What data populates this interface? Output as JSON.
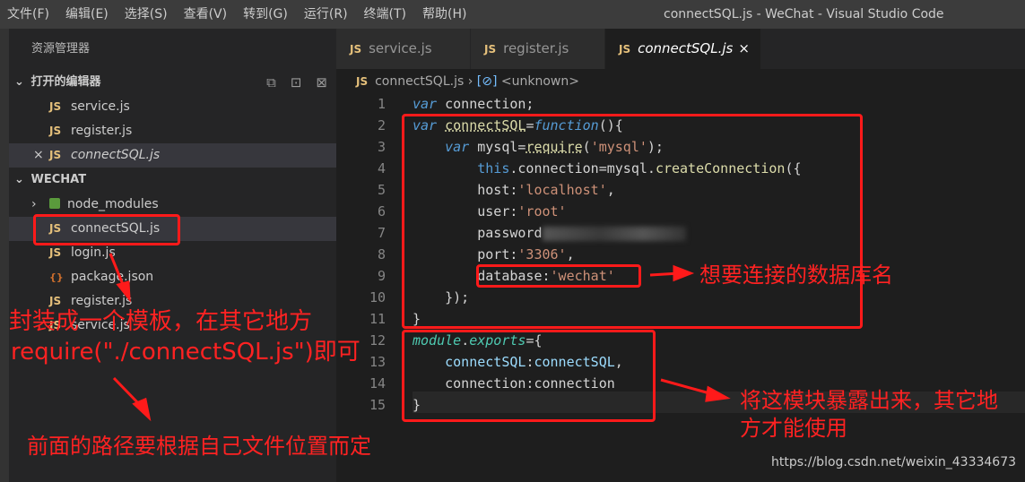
{
  "menubar": {
    "items": [
      "文件(F)",
      "编辑(E)",
      "选择(S)",
      "查看(V)",
      "转到(G)",
      "运行(R)",
      "终端(T)",
      "帮助(H)"
    ],
    "window_title": "connectSQL.js - WeChat - Visual Studio Code"
  },
  "sidebar": {
    "title": "资源管理器",
    "open_editors": {
      "label": "打开的编辑器",
      "files": [
        {
          "icon": "JS",
          "name": "service.js"
        },
        {
          "icon": "JS",
          "name": "register.js"
        },
        {
          "icon": "JS",
          "name": "connectSQL.js",
          "close": "×"
        }
      ]
    },
    "project": {
      "label": "WECHAT",
      "items": [
        {
          "name": "node_modules"
        },
        {
          "icon": "JS",
          "name": "connectSQL.js"
        },
        {
          "icon": "JS",
          "name": "login.js"
        },
        {
          "icon": "{}",
          "name": "package.json"
        },
        {
          "icon": "JS",
          "name": "register.js"
        },
        {
          "icon": "JS",
          "name": "service.js"
        }
      ]
    }
  },
  "tabs": [
    {
      "icon": "JS",
      "label": "service.js"
    },
    {
      "icon": "JS",
      "label": "register.js"
    },
    {
      "icon": "JS",
      "label": "connectSQL.js",
      "close": "×"
    }
  ],
  "breadcrumb": {
    "file": "connectSQL.js",
    "separator": "›",
    "symbol": "<unknown>"
  },
  "editor": {
    "line_numbers": [
      "1",
      "2",
      "3",
      "4",
      "5",
      "6",
      "7",
      "8",
      "9",
      "10",
      "11",
      "12",
      "13",
      "14",
      "15"
    ],
    "lines": [
      [
        [
          "kw",
          "var"
        ],
        [
          "pl",
          " connection;"
        ]
      ],
      [
        [
          "kw",
          "var"
        ],
        [
          "pl",
          " "
        ],
        [
          "fnv",
          "connectSQL"
        ],
        [
          "op",
          "="
        ],
        [
          "kw",
          "function"
        ],
        [
          "pl",
          "(){"
        ]
      ],
      [
        [
          "pl",
          "    "
        ],
        [
          "kw",
          "var"
        ],
        [
          "pl",
          " mysql"
        ],
        [
          "op",
          "="
        ],
        [
          "fnv",
          "require"
        ],
        [
          "pl",
          "("
        ],
        [
          "str",
          "'mysql'"
        ],
        [
          "pl",
          ");"
        ]
      ],
      [
        [
          "pl",
          "        "
        ],
        [
          "this",
          "this"
        ],
        [
          "pl",
          ".connection"
        ],
        [
          "op",
          "="
        ],
        [
          "pl",
          "mysql."
        ],
        [
          "mem",
          "createConnection"
        ],
        [
          "pl",
          "({"
        ]
      ],
      [
        [
          "pl",
          "        host:"
        ],
        [
          "str",
          "'localhost'"
        ],
        [
          "pl",
          ","
        ]
      ],
      [
        [
          "pl",
          "        user:"
        ],
        [
          "str",
          "'root'"
        ]
      ],
      [
        [
          "pl",
          "        password"
        ]
      ],
      [
        [
          "pl",
          "        port:"
        ],
        [
          "str",
          "'3306'"
        ],
        [
          "pl",
          ","
        ]
      ],
      [
        [
          "pl",
          "        database:"
        ],
        [
          "str",
          "'wechat'"
        ]
      ],
      [
        [
          "pl",
          "    });"
        ]
      ],
      [
        [
          "pl",
          "}"
        ]
      ],
      [
        [
          "mod",
          "module"
        ],
        [
          "pl",
          "."
        ],
        [
          "mod",
          "exports"
        ],
        [
          "op",
          "="
        ],
        [
          "pl",
          "{"
        ]
      ],
      [
        [
          "pl",
          "    "
        ],
        [
          "var",
          "connectSQL"
        ],
        [
          "pl",
          ":"
        ],
        [
          "var",
          "connectSQL"
        ],
        [
          "pl",
          ","
        ]
      ],
      [
        [
          "pl",
          "    connection:connection"
        ]
      ],
      [
        [
          "pl",
          "}"
        ]
      ]
    ]
  },
  "annotations": {
    "db_name": "想要连接的数据库名",
    "template_line1": "封装成一个模板，在其它地方",
    "template_line2": "require(\"./connectSQL.js\")即可",
    "path_note": "前面的路径要根据自己文件位置而定",
    "export_line1": "将这模块暴露出来，其它地",
    "export_line2": "方才能使用"
  },
  "watermark": "https://blog.csdn.net/weixin_43334673",
  "colors": {
    "annotation_red": "#ff1a1a",
    "js_icon": "#e5c07b",
    "keyword": "#569cd6",
    "string": "#ce9178"
  }
}
